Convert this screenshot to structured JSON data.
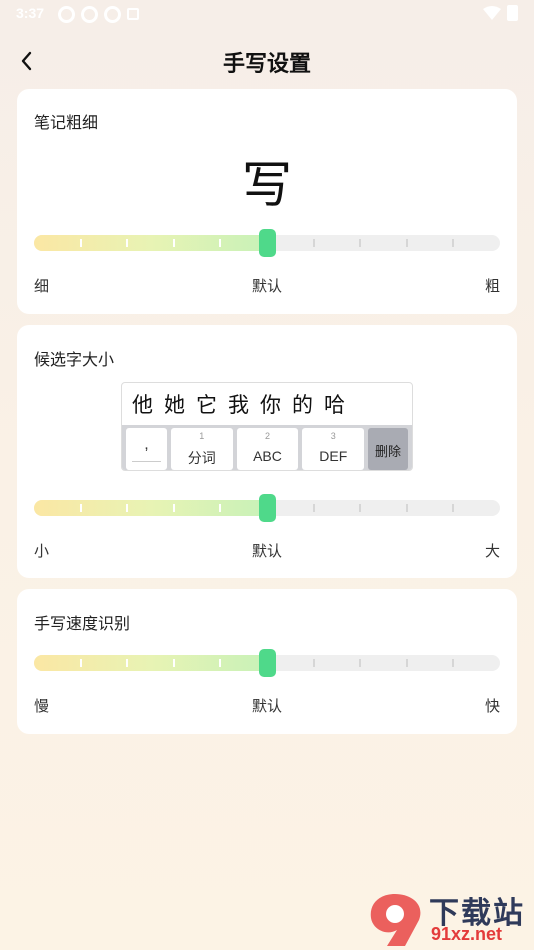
{
  "status_bar": {
    "time": "3:37"
  },
  "header": {
    "title": "手写设置"
  },
  "stroke_card": {
    "title": "笔记粗细",
    "preview_char": "写",
    "slider": {
      "value": 0.5,
      "min_label": "细",
      "mid_label": "默认",
      "max_label": "粗"
    }
  },
  "candidate_card": {
    "title": "候选字大小",
    "candidates": [
      "他",
      "她",
      "它",
      "我",
      "你",
      "的",
      "哈"
    ],
    "keys": [
      {
        "num": "",
        "text": ","
      },
      {
        "num": "1",
        "text": "分词"
      },
      {
        "num": "2",
        "text": "ABC"
      },
      {
        "num": "3",
        "text": "DEF"
      },
      {
        "num": "",
        "text": "删除"
      }
    ],
    "slider": {
      "value": 0.5,
      "min_label": "小",
      "mid_label": "默认",
      "max_label": "大"
    }
  },
  "speed_card": {
    "title": "手写速度识别",
    "slider": {
      "value": 0.5,
      "min_label": "慢",
      "mid_label": "默认",
      "max_label": "快"
    }
  },
  "watermark": {
    "text1": "下载站",
    "text2": "91xz.net"
  },
  "colors": {
    "accent": "#4fd98a",
    "card": "#ffffff"
  }
}
